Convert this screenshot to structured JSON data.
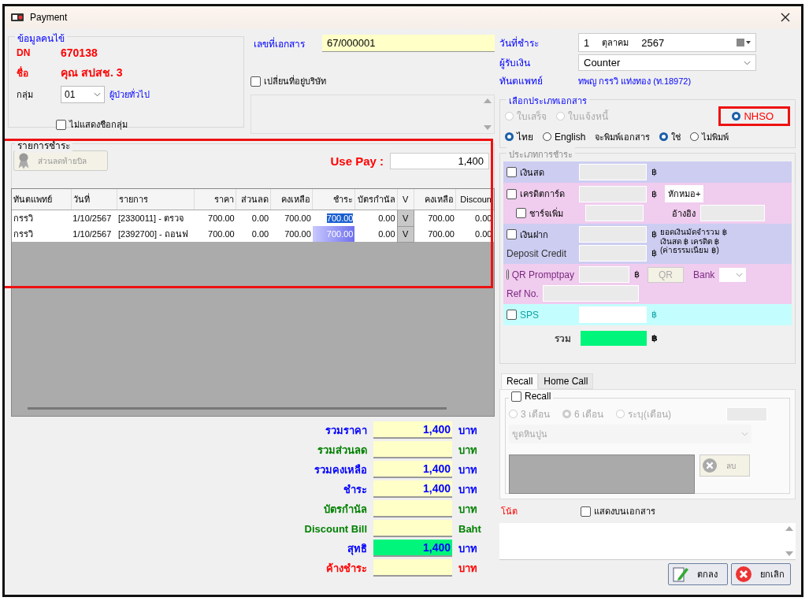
{
  "window": {
    "title": "Payment"
  },
  "patient": {
    "legend": "ข้อมูลคนไข้",
    "dn_label": "DN",
    "dn": "670138",
    "name_label": "ชื่อ",
    "name": "คุณ สปสช. 3",
    "group_label": "กลุ่ม",
    "group": "01",
    "group_name": "ผู้ป่วยทั่วไป",
    "hide_group": {
      "label": "ไม่แสดงชือกลุ่ม",
      "checked": false
    }
  },
  "document": {
    "label": "เลขที่เอกสาร",
    "value": "67/000001",
    "change_address": {
      "label": "เปลี่ยนที่อยู่บริษัท",
      "checked": false
    }
  },
  "payment_info": {
    "date_label": "วันที่ชำระ",
    "day": "1",
    "month": "ตุลาคม",
    "year": "2567",
    "cashier_label": "ผู้รับเงิน",
    "cashier": "Counter",
    "dentist_label": "ทันตแพทย์",
    "dentist": "ทพญ กรรวิ แท่งทอง (ท.18972)"
  },
  "doc_type": {
    "legend": "เลือกประเภทเอกสาร",
    "options": [
      {
        "label": "ใบเสร็จ",
        "selected": false,
        "disabled": true,
        "highlighted": false
      },
      {
        "label": "ใบแจ้งหนี้",
        "selected": false,
        "disabled": true,
        "highlighted": false
      },
      {
        "label": "NHSO",
        "selected": true,
        "disabled": false,
        "highlighted": true
      }
    ],
    "languages": [
      {
        "label": "ไทย",
        "selected": true
      },
      {
        "label": "English",
        "selected": false
      }
    ],
    "print_label": "จะพิมพ์เอกสาร",
    "print_options": [
      {
        "label": "ใช่",
        "selected": true
      },
      {
        "label": "ไม่พิมพ์",
        "selected": false
      }
    ]
  },
  "items": {
    "legend": "รายการชำระ",
    "highlighted": true,
    "discount_button": "ส่วนลดท้ายบิล",
    "use_pay_label": "Use Pay :",
    "use_pay": "1,400",
    "columns": [
      "ทันตแพทย์",
      "วันที่",
      "รายการ",
      "ราคา",
      "ส่วนลด",
      "คงเหลือ",
      "ชำระ",
      "บัตรกำนัล",
      "V",
      "คงเหลือ",
      "Discoun"
    ],
    "rows": [
      {
        "editing": true,
        "cells": [
          "กรรวิ",
          "1/10/2567",
          "[2330011]  - ตรวจ",
          "700.00",
          "0.00",
          "700.00",
          "700.00",
          "0.00",
          "V",
          "700.00",
          "0.00"
        ]
      },
      {
        "editing": false,
        "cells": [
          "กรรวิ",
          "1/10/2567",
          "[2392700]  - ถอนฟ",
          "700.00",
          "0.00",
          "700.00",
          "700.00",
          "0.00",
          "V",
          "700.00",
          "0.00"
        ]
      }
    ]
  },
  "totals": [
    {
      "label": "รวมราคา",
      "value": "1,400",
      "unit": "บาท",
      "color": "#0000ff",
      "highlighted": false
    },
    {
      "label": "รวมส่วนลด",
      "unit": "บาท",
      "color": "#008000",
      "highlighted": false
    },
    {
      "label": "รวมคงเหลือ",
      "value": "1,400",
      "unit": "บาท",
      "color": "#0000ff",
      "highlighted": false
    },
    {
      "label": "ชำระ",
      "value": "1,400",
      "unit": "บาท",
      "color": "#0000ff",
      "highlighted": false
    },
    {
      "label": "บัตรกำนัล",
      "unit": "บาท",
      "color": "#008000",
      "highlighted": false
    },
    {
      "label": "Discount Bill",
      "unit": "Baht",
      "color": "#008000",
      "highlighted": false
    },
    {
      "label": "สุทธิ",
      "value": "1,400",
      "unit": "บาท",
      "color": "#0000ff",
      "highlighted": true
    },
    {
      "label": "ค้างชำระ",
      "unit": "บาท",
      "color": "#ff0000",
      "highlighted": false
    }
  ],
  "payment_types": {
    "legend": "ประเภทการชำระ",
    "cash": {
      "label": "เงินสด",
      "checked": false,
      "currency": "฿"
    },
    "credit": {
      "label": "เครดิตการ์ด",
      "checked": false,
      "currency": "฿",
      "fee_option": "หักหมอ+",
      "surcharge": {
        "label": "ชาร์จเพิ่ม",
        "checked": false
      },
      "reference_label": "อ้างอิง"
    },
    "deposit": {
      "label": "เงินฝาก",
      "checked": false,
      "currency": "฿",
      "credit_label": "Deposit Credit",
      "credit_currency": "฿",
      "notes": [
        "ยอดเงินมัดจำรวม ฿",
        "เงินสด ฿  เครดิต ฿",
        "(ค่าธรรมเนียม ฿)"
      ]
    },
    "qr": {
      "label": "QR Promptpay",
      "checked": false,
      "currency": "฿",
      "button": "QR",
      "bank_label": "Bank",
      "ref_label": "Ref No."
    },
    "sps": {
      "label": "SPS",
      "checked": false,
      "currency": "฿"
    },
    "total_label": "รวม",
    "total_currency": "฿"
  },
  "tabs": [
    {
      "label": "Recall",
      "selected": true
    },
    {
      "label": "Home Call",
      "selected": false
    }
  ],
  "recall": {
    "checkbox": {
      "label": "Recall",
      "checked": false
    },
    "periods": [
      {
        "label": "3 เดือน",
        "selected": false
      },
      {
        "label": "6 เดือน",
        "selected": true
      },
      {
        "label": "ระบุ(เดือน)",
        "selected": false
      }
    ],
    "procedure": "ขูดหินปูน",
    "delete_button": "ลบ"
  },
  "note": {
    "label": "โน้ต",
    "show_on_doc": {
      "label": "แสดงบนเอกสาร",
      "checked": false
    }
  },
  "buttons": [
    {
      "kind": "ok",
      "label": "ตกลง"
    },
    {
      "kind": "cancel",
      "label": "ยกเลิก"
    }
  ]
}
